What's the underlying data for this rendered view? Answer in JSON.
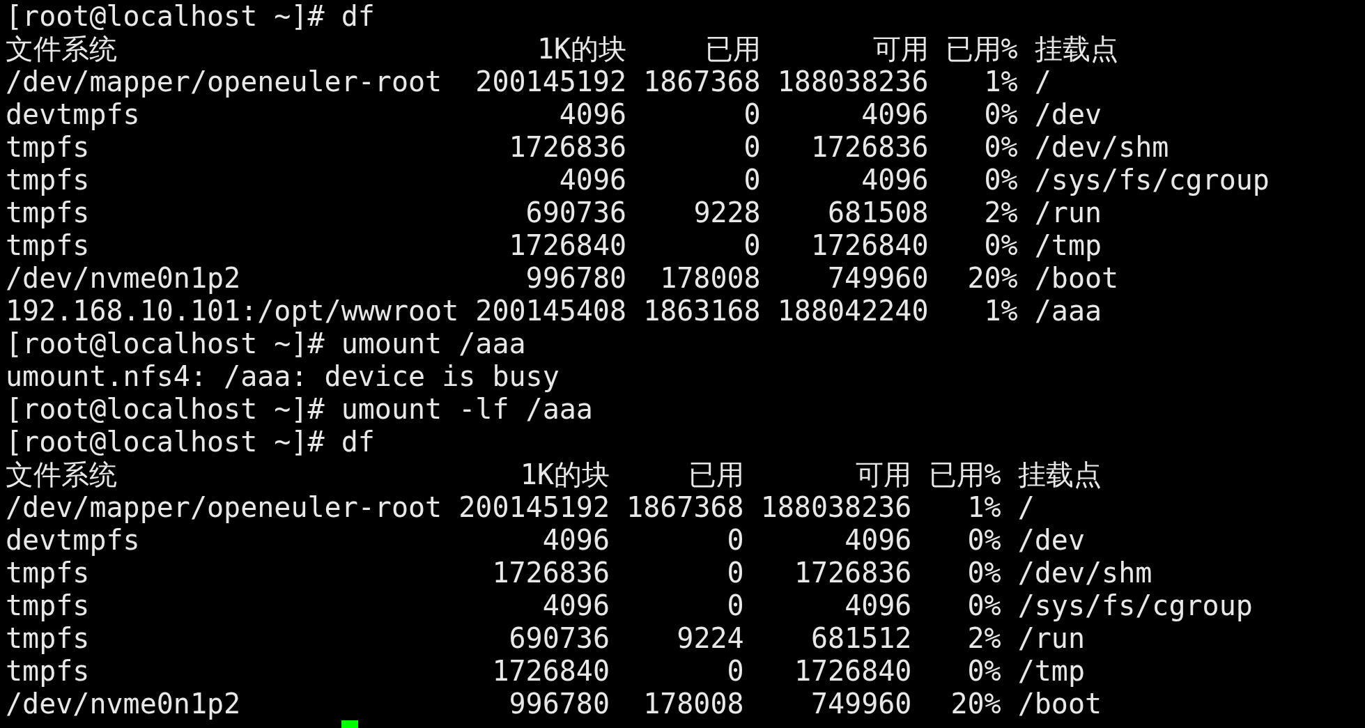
{
  "blocks": [
    {
      "kind": "command",
      "text": "[root@localhost ~]# df"
    },
    {
      "kind": "table",
      "columns": [
        "文件系统",
        "1K的块",
        "已用",
        "可用",
        "已用%",
        "挂载点"
      ],
      "rows": [
        [
          "/dev/mapper/openeuler-root",
          "200145192",
          "1867368",
          "188038236",
          "1%",
          "/"
        ],
        [
          "devtmpfs",
          "4096",
          "0",
          "4096",
          "0%",
          "/dev"
        ],
        [
          "tmpfs",
          "1726836",
          "0",
          "1726836",
          "0%",
          "/dev/shm"
        ],
        [
          "tmpfs",
          "4096",
          "0",
          "4096",
          "0%",
          "/sys/fs/cgroup"
        ],
        [
          "tmpfs",
          "690736",
          "9228",
          "681508",
          "2%",
          "/run"
        ],
        [
          "tmpfs",
          "1726840",
          "0",
          "1726840",
          "0%",
          "/tmp"
        ],
        [
          "/dev/nvme0n1p2",
          "996780",
          "178008",
          "749960",
          "20%",
          "/boot"
        ],
        [
          "192.168.10.101:/opt/wwwroot",
          "200145408",
          "1863168",
          "188042240",
          "1%",
          "/aaa"
        ]
      ]
    },
    {
      "kind": "command",
      "text": "[root@localhost ~]# umount /aaa"
    },
    {
      "kind": "output",
      "text": "umount.nfs4: /aaa: device is busy"
    },
    {
      "kind": "command",
      "text": "[root@localhost ~]# umount -lf /aaa"
    },
    {
      "kind": "command",
      "text": "[root@localhost ~]# df"
    },
    {
      "kind": "table",
      "columns": [
        "文件系统",
        "1K的块",
        "已用",
        "可用",
        "已用%",
        "挂载点"
      ],
      "rows": [
        [
          "/dev/mapper/openeuler-root",
          "200145192",
          "1867368",
          "188038236",
          "1%",
          "/"
        ],
        [
          "devtmpfs",
          "4096",
          "0",
          "4096",
          "0%",
          "/dev"
        ],
        [
          "tmpfs",
          "1726836",
          "0",
          "1726836",
          "0%",
          "/dev/shm"
        ],
        [
          "tmpfs",
          "4096",
          "0",
          "4096",
          "0%",
          "/sys/fs/cgroup"
        ],
        [
          "tmpfs",
          "690736",
          "9224",
          "681512",
          "2%",
          "/run"
        ],
        [
          "tmpfs",
          "1726840",
          "0",
          "1726840",
          "0%",
          "/tmp"
        ],
        [
          "/dev/nvme0n1p2",
          "996780",
          "178008",
          "749960",
          "20%",
          "/boot"
        ]
      ]
    }
  ]
}
